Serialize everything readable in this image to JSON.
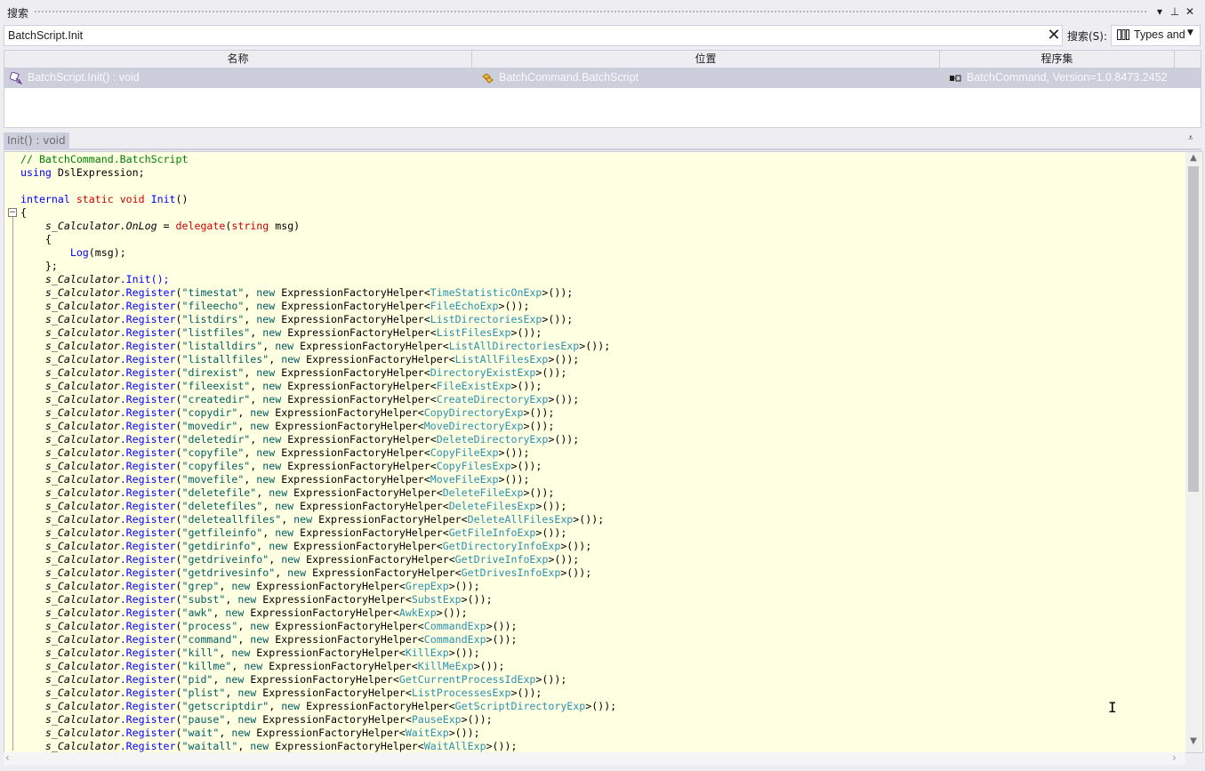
{
  "panel": {
    "title": "搜索",
    "buttons": {
      "menu": "▾",
      "pin": "⊥",
      "close": "✕"
    }
  },
  "search": {
    "value": "BatchScript.Init",
    "clear_glyph": "✕",
    "scope_label": "搜索(S):",
    "scope_value": "Types and Members",
    "scope_arrow": "▼"
  },
  "results": {
    "columns": [
      "名称",
      "位置",
      "程序集"
    ],
    "rows": [
      {
        "name": "BatchScript.Init() : void",
        "location": "BatchCommand.BatchScript",
        "assembly": "BatchCommand, Version=1.0.8473.2452"
      }
    ]
  },
  "detail": {
    "tab_label": "Init() : void",
    "menu_glyph": "⩡"
  },
  "code": {
    "header_comment": "// BatchCommand.BatchScript",
    "using_kw": "using",
    "using_ns": " DslExpression;",
    "sig_internal": "internal",
    "sig_static": "static",
    "sig_void": "void",
    "sig_name": "Init",
    "sig_tail": "()",
    "open_brace": "{",
    "close_brace": "}",
    "delegate_target": "s_Calculator",
    "delegate_member": ".OnLog",
    "delegate_assign": " = ",
    "delegate_kw": "delegate",
    "delegate_param_type": "string",
    "delegate_param": " msg)",
    "log_call": "Log",
    "log_args": "(msg);",
    "close_delegate": "};",
    "init_call_target": "s_Calculator",
    "init_call": ".Init();",
    "register_target": "s_Calculator",
    "register_method": ".Register",
    "new_kw": "new",
    "helper_type": "ExpressionFactoryHelper",
    "registrations": [
      {
        "name": "\"timestat\"",
        "exp": "TimeStatisticOnExp"
      },
      {
        "name": "\"fileecho\"",
        "exp": "FileEchoExp"
      },
      {
        "name": "\"listdirs\"",
        "exp": "ListDirectoriesExp"
      },
      {
        "name": "\"listfiles\"",
        "exp": "ListFilesExp"
      },
      {
        "name": "\"listalldirs\"",
        "exp": "ListAllDirectoriesExp"
      },
      {
        "name": "\"listallfiles\"",
        "exp": "ListAllFilesExp"
      },
      {
        "name": "\"direxist\"",
        "exp": "DirectoryExistExp"
      },
      {
        "name": "\"fileexist\"",
        "exp": "FileExistExp"
      },
      {
        "name": "\"createdir\"",
        "exp": "CreateDirectoryExp"
      },
      {
        "name": "\"copydir\"",
        "exp": "CopyDirectoryExp"
      },
      {
        "name": "\"movedir\"",
        "exp": "MoveDirectoryExp"
      },
      {
        "name": "\"deletedir\"",
        "exp": "DeleteDirectoryExp"
      },
      {
        "name": "\"copyfile\"",
        "exp": "CopyFileExp"
      },
      {
        "name": "\"copyfiles\"",
        "exp": "CopyFilesExp"
      },
      {
        "name": "\"movefile\"",
        "exp": "MoveFileExp"
      },
      {
        "name": "\"deletefile\"",
        "exp": "DeleteFileExp"
      },
      {
        "name": "\"deletefiles\"",
        "exp": "DeleteFilesExp"
      },
      {
        "name": "\"deleteallfiles\"",
        "exp": "DeleteAllFilesExp"
      },
      {
        "name": "\"getfileinfo\"",
        "exp": "GetFileInfoExp"
      },
      {
        "name": "\"getdirinfo\"",
        "exp": "GetDirectoryInfoExp"
      },
      {
        "name": "\"getdriveinfo\"",
        "exp": "GetDriveInfoExp"
      },
      {
        "name": "\"getdrivesinfo\"",
        "exp": "GetDrivesInfoExp"
      },
      {
        "name": "\"grep\"",
        "exp": "GrepExp"
      },
      {
        "name": "\"subst\"",
        "exp": "SubstExp"
      },
      {
        "name": "\"awk\"",
        "exp": "AwkExp"
      },
      {
        "name": "\"process\"",
        "exp": "CommandExp"
      },
      {
        "name": "\"command\"",
        "exp": "CommandExp"
      },
      {
        "name": "\"kill\"",
        "exp": "KillExp"
      },
      {
        "name": "\"killme\"",
        "exp": "KillMeExp"
      },
      {
        "name": "\"pid\"",
        "exp": "GetCurrentProcessIdExp"
      },
      {
        "name": "\"plist\"",
        "exp": "ListProcessesExp"
      },
      {
        "name": "\"getscriptdir\"",
        "exp": "GetScriptDirectoryExp"
      },
      {
        "name": "\"pause\"",
        "exp": "PauseExp"
      },
      {
        "name": "\"wait\"",
        "exp": "WaitExp"
      },
      {
        "name": "\"waitall\"",
        "exp": "WaitAllExp"
      }
    ]
  },
  "scrollbars": {
    "up": "▲",
    "down": "▼",
    "left": "‹",
    "right": "›"
  },
  "colors": {
    "panel_bg": "#eeeef2",
    "code_bg": "#ffffe1",
    "selected_row": "#cccedb",
    "keyword": "#0000ff",
    "modifier_keyword": "#cc0000",
    "comment": "#008000",
    "string": "#006060",
    "type": "#2b91af"
  },
  "icons": {
    "method": "method-icon",
    "class": "class-icon",
    "assembly": "assembly-icon",
    "scope": "scope-icon"
  }
}
